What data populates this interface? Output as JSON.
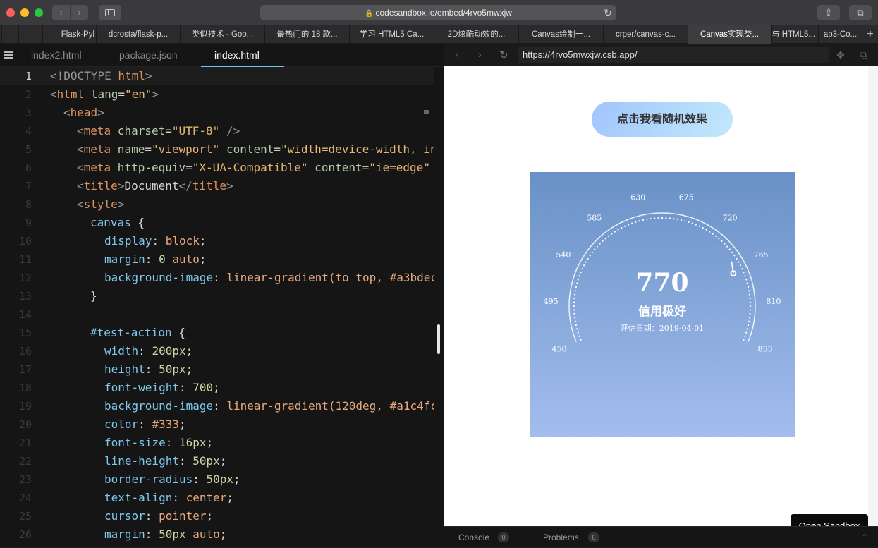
{
  "browser": {
    "url": "codesandbox.io/embed/4rvo5mwxjw",
    "tabs": [
      {
        "label": ""
      },
      {
        "label": ""
      },
      {
        "label": "Flask-Pyl"
      },
      {
        "label": "dcrosta/flask-p..."
      },
      {
        "label": "类似技术 - Goo..."
      },
      {
        "label": "最热门的 18 款..."
      },
      {
        "label": "学习 HTML5 Ca..."
      },
      {
        "label": "2D炫酷动效的..."
      },
      {
        "label": "Canvas绘制一..."
      },
      {
        "label": "crper/canvas-c..."
      },
      {
        "label": "Canvas实现类..."
      },
      {
        "label": "与 HTML5..."
      },
      {
        "label": "ap3-Co..."
      }
    ],
    "active_tab_index": 10
  },
  "editor": {
    "files": [
      "index2.html",
      "package.json",
      "index.html"
    ],
    "active_file": "index.html",
    "current_line": 1,
    "lines": [
      {
        "n": "1"
      },
      {
        "n": "2"
      },
      {
        "n": "3"
      },
      {
        "n": "4"
      },
      {
        "n": "5"
      },
      {
        "n": "6"
      },
      {
        "n": "7"
      },
      {
        "n": "8"
      },
      {
        "n": "9"
      },
      {
        "n": "10"
      },
      {
        "n": "11"
      },
      {
        "n": "12"
      },
      {
        "n": "13"
      },
      {
        "n": "14"
      },
      {
        "n": "15"
      },
      {
        "n": "16"
      },
      {
        "n": "17"
      },
      {
        "n": "18"
      },
      {
        "n": "19"
      },
      {
        "n": "20"
      },
      {
        "n": "21"
      },
      {
        "n": "22"
      },
      {
        "n": "23"
      },
      {
        "n": "24"
      },
      {
        "n": "25"
      },
      {
        "n": "26"
      }
    ],
    "code": {
      "l1": [
        "<!DOCTYPE ",
        "html",
        ">"
      ],
      "l2": [
        "<",
        "html",
        " lang",
        "=",
        "\"en\"",
        ">"
      ],
      "l3": [
        "<",
        "head",
        ">"
      ],
      "l4": [
        "<",
        "meta",
        " charset",
        "=",
        "\"UTF-8\"",
        " />"
      ],
      "l5": [
        "<",
        "meta",
        " name",
        "=",
        "\"viewport\"",
        " content",
        "=",
        "\"width=device-width, in"
      ],
      "l6": [
        "<",
        "meta",
        " http-equiv",
        "=",
        "\"X-UA-Compatible\"",
        " content",
        "=",
        "\"ie=edge\""
      ],
      "l7": [
        "<",
        "title",
        ">",
        "Document",
        "</",
        "title",
        ">"
      ],
      "l8": [
        "<",
        "style",
        ">"
      ],
      "l9": [
        "canvas",
        " {"
      ],
      "l10": [
        "display",
        ": ",
        "block",
        ";"
      ],
      "l11": [
        "margin",
        ": ",
        "0",
        " auto",
        ";"
      ],
      "l12": [
        "background-image",
        ": ",
        "linear-gradient(to top, #a3bdec"
      ],
      "l13": [
        "}"
      ],
      "l15": [
        "#test-action",
        " {"
      ],
      "l16": [
        "width",
        ": ",
        "200px",
        ";"
      ],
      "l17": [
        "height",
        ": ",
        "50px",
        ";"
      ],
      "l18": [
        "font-weight",
        ": ",
        "700",
        ";"
      ],
      "l19": [
        "background-image",
        ": ",
        "linear-gradient(120deg, #a1c4fc"
      ],
      "l20": [
        "color",
        ": ",
        "#333",
        ";"
      ],
      "l21": [
        "font-size",
        ": ",
        "16px",
        ";"
      ],
      "l22": [
        "line-height",
        ": ",
        "50px",
        ";"
      ],
      "l23": [
        "border-radius",
        ": ",
        "50px",
        ";"
      ],
      "l24": [
        "text-align",
        ": ",
        "center",
        ";"
      ],
      "l25": [
        "cursor",
        ": ",
        "pointer",
        ";"
      ],
      "l26": [
        "margin",
        ": ",
        "50px",
        " auto",
        ";"
      ]
    }
  },
  "preview": {
    "url": "https://4rvo5mwxjw.csb.app/",
    "action_button": "点击我看随机效果",
    "open_sandbox": "Open Sandbox",
    "console_label": "Console",
    "console_count": "0",
    "problems_label": "Problems",
    "problems_count": "0",
    "gauge": {
      "min": 450,
      "max": 855,
      "score": 770,
      "score_text": "770",
      "rating": "信用极好",
      "date_label": "评估日期：2019-04-01",
      "tick_labels": [
        "450",
        "495",
        "540",
        "585",
        "630",
        "675",
        "720",
        "765",
        "810",
        "855"
      ],
      "colors": {
        "gradient_top": "#6991c7",
        "gradient_bottom": "#a3bded",
        "text": "#ffffff"
      }
    }
  }
}
